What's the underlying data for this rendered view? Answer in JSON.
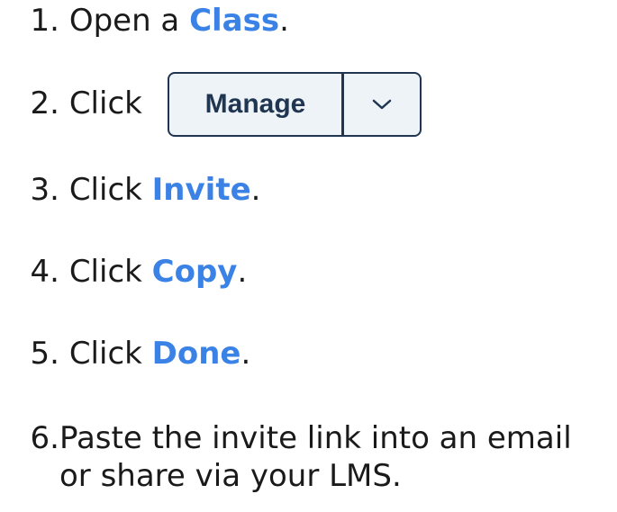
{
  "steps": [
    {
      "number": "1.",
      "prefix": "Open a ",
      "keyword": "Class",
      "suffix": "."
    },
    {
      "number": "2.",
      "prefix": "Click"
    },
    {
      "number": "3.",
      "prefix": "Click ",
      "keyword": "Invite",
      "suffix": "."
    },
    {
      "number": "4.",
      "prefix": "Click ",
      "keyword": "Copy",
      "suffix": "."
    },
    {
      "number": "5.",
      "prefix": "Click ",
      "keyword": "Done",
      "suffix": "."
    },
    {
      "number": "6.",
      "line1": "Paste the invite link into an email",
      "line2": "or share via your LMS."
    }
  ],
  "manage_button": {
    "label": "Manage",
    "dropdown_icon": "chevron-down-icon"
  },
  "colors": {
    "keyword": "#3b82e6",
    "button_border": "#1f3550",
    "button_fill": "#eef3f8"
  }
}
